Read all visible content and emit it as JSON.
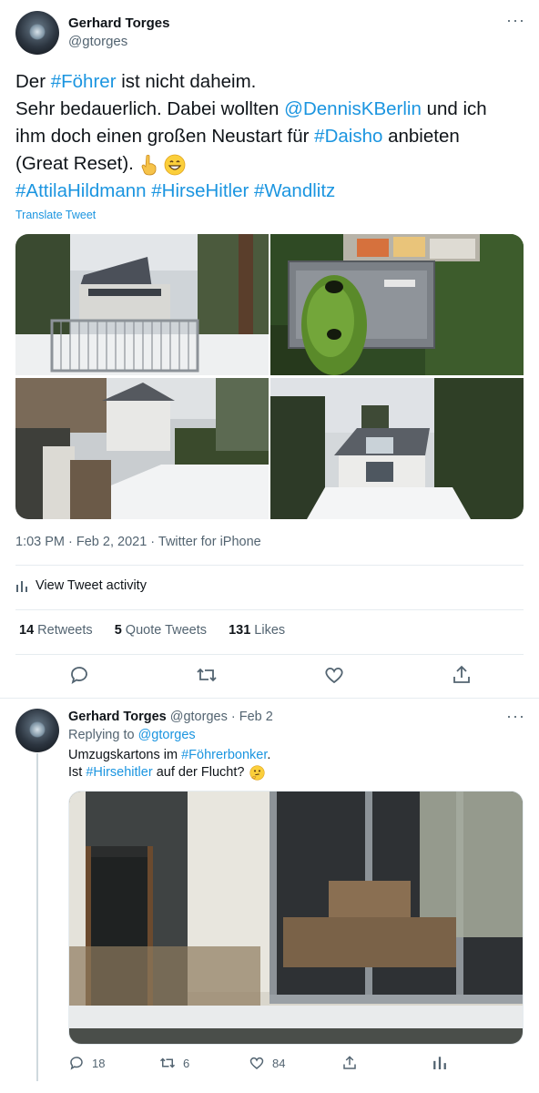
{
  "main_tweet": {
    "author_name": "Gerhard Torges",
    "author_handle": "@gtorges",
    "text": {
      "line1_pre": "Der ",
      "line1_hashtag": "#Föhrer",
      "line1_post": " ist nicht daheim.",
      "line2_pre": "Sehr bedauerlich. Dabei wollten ",
      "line2_mention": "@DennisKBerlin",
      "line2_post": " und ich",
      "line3_pre": "ihm doch einen großen Neustart für ",
      "line3_hashtag": "#Daisho",
      "line3_post": " anbieten",
      "line4_text": "(Great Reset).",
      "line5_hashtags": "#AttilaHildmann #HirseHitler #Wandlitz"
    },
    "translate_label": "Translate Tweet",
    "timestamp": "1:03 PM · Feb 2, 2021 · Twitter for iPhone",
    "activity_label": "View Tweet activity",
    "stats": {
      "retweets_count": "14",
      "retweets_label": "Retweets",
      "quotes_count": "5",
      "quotes_label": "Quote Tweets",
      "likes_count": "131",
      "likes_label": "Likes"
    },
    "icons": [
      "reply-icon",
      "retweet-icon",
      "like-icon",
      "share-icon",
      "more-icon",
      "analytics-icon"
    ]
  },
  "reply_tweet": {
    "author_name": "Gerhard Torges",
    "author_handle": "@gtorges",
    "date": "· Feb 2",
    "replying_label": "Replying to ",
    "replying_to": "@gtorges",
    "text_line1_pre": "Umzugskartons im ",
    "text_line1_hashtag": "#Föhrerbonker",
    "text_line1_post": ".",
    "text_line2_pre": "Ist ",
    "text_line2_hashtag": "#Hirsehitler",
    "text_line2_post": " auf der Flucht?",
    "reply_count": "18",
    "retweet_count": "6",
    "like_count": "84"
  },
  "colors": {
    "link": "#1b95e0",
    "text": "#0f1419",
    "secondary": "#536471",
    "divider": "#e6ecf0"
  }
}
